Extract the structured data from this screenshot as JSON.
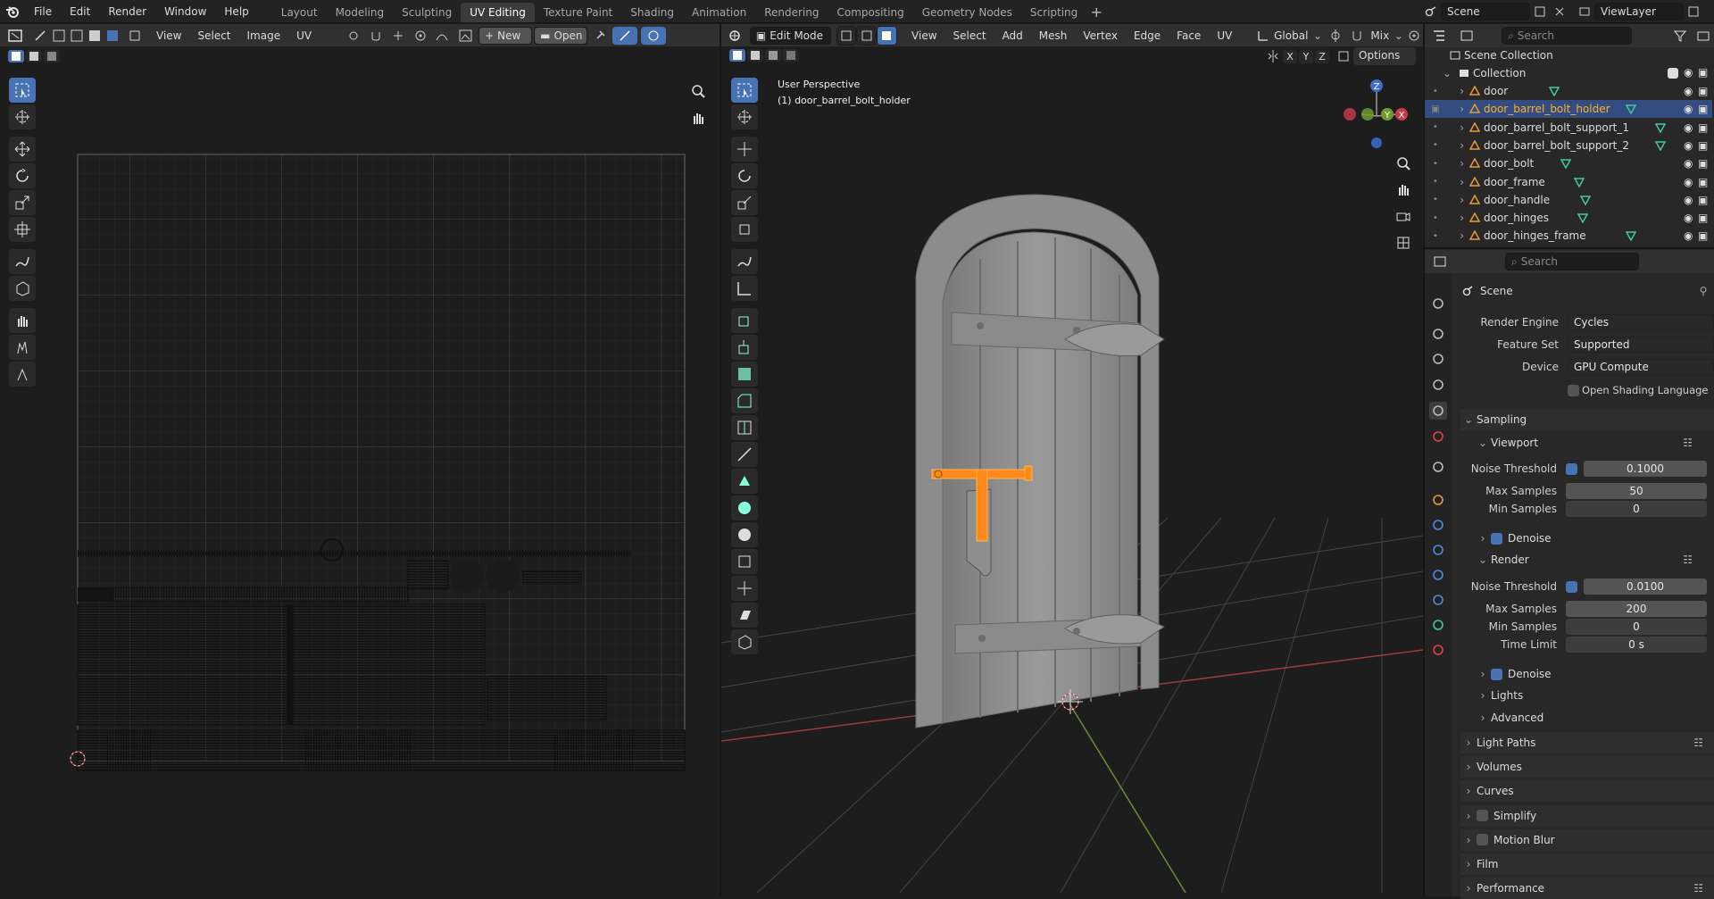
{
  "topbar": {
    "menus": [
      "File",
      "Edit",
      "Render",
      "Window",
      "Help"
    ],
    "workspaces": [
      "Layout",
      "Modeling",
      "Sculpting",
      "UV Editing",
      "Texture Paint",
      "Shading",
      "Animation",
      "Rendering",
      "Compositing",
      "Geometry Nodes",
      "Scripting"
    ],
    "active_workspace": "UV Editing",
    "scene": "Scene",
    "view_layer": "ViewLayer"
  },
  "uv_editor": {
    "menus": [
      "View",
      "Select",
      "Image",
      "UV"
    ],
    "new_label": "New",
    "open_label": "Open"
  },
  "viewport": {
    "mode": "Edit Mode",
    "menus": [
      "View",
      "Select",
      "Add",
      "Mesh",
      "Vertex",
      "Edge",
      "Face",
      "UV"
    ],
    "orientation": "Global",
    "shading": "Mix",
    "options_label": "Options",
    "axes": [
      "X",
      "Y",
      "Z"
    ],
    "overlay_title": "User Perspective",
    "overlay_object": "(1) door_barrel_bolt_holder",
    "colors": {
      "selection": "#ff8a1a",
      "mesh": "#8f8f8f",
      "x_axis": "#c94a4a",
      "y_axis": "#7fa33a"
    }
  },
  "outliner": {
    "search_placeholder": "Search",
    "scene_collection": "Scene Collection",
    "collection": "Collection",
    "items": [
      "door",
      "door_barrel_bolt_holder",
      "door_barrel_bolt_support_1",
      "door_barrel_bolt_support_2",
      "door_bolt",
      "door_frame",
      "door_handle",
      "door_hinges",
      "door_hinges_frame"
    ],
    "selected": "door_barrel_bolt_holder"
  },
  "properties": {
    "search_placeholder": "Search",
    "context": "Scene",
    "render_engine_label": "Render Engine",
    "render_engine": "Cycles",
    "feature_set_label": "Feature Set",
    "feature_set": "Supported",
    "device_label": "Device",
    "device": "GPU Compute",
    "osl_label": "Open Shading Language",
    "sampling_label": "Sampling",
    "viewport_label": "Viewport",
    "noise_threshold_label": "Noise Threshold",
    "max_samples_label": "Max Samples",
    "min_samples_label": "Min Samples",
    "viewport_noise_threshold": "0.1000",
    "viewport_max_samples": "50",
    "viewport_min_samples": "0",
    "denoise_label": "Denoise",
    "render_label": "Render",
    "render_noise_threshold": "0.0100",
    "render_max_samples": "200",
    "render_min_samples": "0",
    "time_limit_label": "Time Limit",
    "time_limit": "0 s",
    "lights_label": "Lights",
    "advanced_label": "Advanced",
    "panels": [
      "Light Paths",
      "Volumes",
      "Curves",
      "Simplify",
      "Motion Blur",
      "Film",
      "Performance"
    ]
  }
}
